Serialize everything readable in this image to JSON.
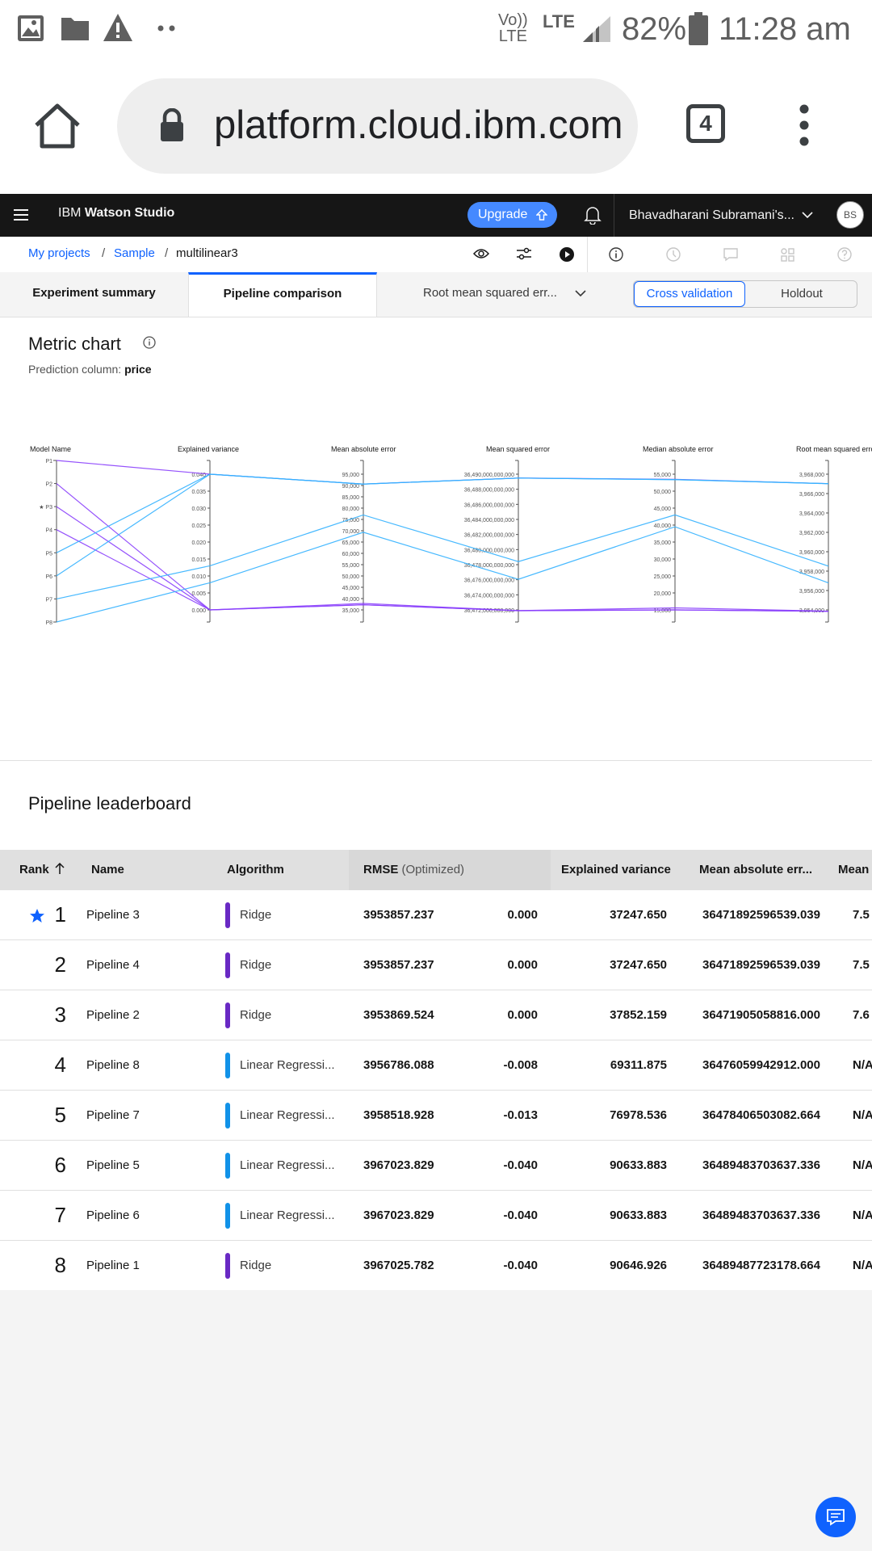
{
  "status_bar": {
    "battery": "82%",
    "time": "11:28 am",
    "net1_top": "Vo))",
    "net1_bottom": "LTE",
    "net2": "LTE"
  },
  "browser": {
    "url": "platform.cloud.ibm.com",
    "tab_count": "4"
  },
  "header": {
    "brand_prefix": "IBM",
    "brand_name": "Watson Studio",
    "upgrade_label": "Upgrade",
    "account_name": "Bhavadharani Subramani's...",
    "avatar_initials": "BS"
  },
  "breadcrumb": {
    "projects": "My projects",
    "sample": "Sample",
    "current": "multilinear3"
  },
  "tabs": {
    "summary": "Experiment summary",
    "comparison": "Pipeline comparison",
    "metric_select": "Root mean squared err...",
    "cross_validation": "Cross validation",
    "holdout": "Holdout"
  },
  "metric_chart": {
    "title": "Metric chart",
    "prediction_label": "Prediction column:",
    "prediction_value": "price"
  },
  "chart_data": {
    "type": "parallel-coordinates",
    "axes": [
      {
        "name": "Model Name",
        "ticks": [
          "P1",
          "P2",
          "★ P3",
          "P4",
          "P5",
          "P6",
          "P7",
          "P8"
        ]
      },
      {
        "name": "Explained variance",
        "ticks": [
          "0.040",
          "0.035",
          "0.030",
          "0.025",
          "0.020",
          "0.015",
          "0.010",
          "0.005",
          "0.000"
        ],
        "range": [
          0.0,
          0.04
        ]
      },
      {
        "name": "Mean absolute error",
        "ticks": [
          "95,000",
          "90,000",
          "85,000",
          "80,000",
          "75,000",
          "70,000",
          "65,000",
          "60,000",
          "55,000",
          "50,000",
          "45,000",
          "40,000",
          "35,000"
        ],
        "range": [
          35000,
          95000
        ]
      },
      {
        "name": "Mean squared error",
        "ticks": [
          "36,490,000,000,000",
          "36,488,000,000,000",
          "36,486,000,000,000",
          "36,484,000,000,000",
          "36,482,000,000,000",
          "36,480,000,000,000",
          "36,478,000,000,000",
          "36,476,000,000,000",
          "36,474,000,000,000",
          "36,472,000,000,000"
        ],
        "range": [
          36472000000000,
          36490000000000
        ]
      },
      {
        "name": "Median absolute error",
        "ticks": [
          "55,000",
          "50,000",
          "45,000",
          "40,000",
          "35,000",
          "30,000",
          "25,000",
          "20,000",
          "15,000"
        ],
        "range": [
          15000,
          55000
        ]
      },
      {
        "name": "Root mean squared error",
        "ticks": [
          "3,968,000",
          "3,966,000",
          "3,964,000",
          "3,962,000",
          "3,960,000",
          "3,958,000",
          "3,956,000",
          "3,954,000"
        ],
        "range": [
          3954000,
          3968000
        ]
      }
    ],
    "series": [
      {
        "model": "P1",
        "algorithm": "Ridge",
        "values": [
          0.04,
          90646.926,
          36489487723178.664,
          53500,
          3967025.782
        ]
      },
      {
        "model": "P2",
        "algorithm": "Ridge",
        "values": [
          0.0,
          37852.159,
          36471905058816.0,
          15600,
          3953869.524
        ]
      },
      {
        "model": "P3",
        "algorithm": "Ridge",
        "values": [
          0.0,
          37247.65,
          36471892596539.04,
          15000,
          3953857.237
        ]
      },
      {
        "model": "P4",
        "algorithm": "Ridge",
        "values": [
          0.0,
          37247.65,
          36471892596539.04,
          15000,
          3953857.237
        ]
      },
      {
        "model": "P5",
        "algorithm": "Linear Regression",
        "values": [
          0.04,
          90633.883,
          36489483703637.336,
          53400,
          3967023.829
        ]
      },
      {
        "model": "P6",
        "algorithm": "Linear Regression",
        "values": [
          0.04,
          90633.883,
          36489483703637.336,
          53400,
          3967023.829
        ]
      },
      {
        "model": "P7",
        "algorithm": "Linear Regression",
        "values": [
          0.013,
          76978.536,
          36478406503082.664,
          43000,
          3958518.928
        ]
      },
      {
        "model": "P8",
        "algorithm": "Linear Regression",
        "values": [
          0.008,
          69311.875,
          36476059942912.0,
          39500,
          3956786.088
        ]
      }
    ],
    "colors": {
      "Ridge": "#8a3ffc",
      "Linear Regression": "#33b1ff"
    }
  },
  "leaderboard": {
    "title": "Pipeline leaderboard",
    "headers": {
      "rank": "Rank",
      "name": "Name",
      "algorithm": "Algorithm",
      "rmse": "RMSE",
      "rmse_note": "(Optimized)",
      "explained_variance": "Explained variance",
      "mae": "Mean absolute err...",
      "next": "Mean"
    },
    "rows": [
      {
        "rank": "1",
        "name": "Pipeline 3",
        "algorithm": "Ridge",
        "color": "#6929c4",
        "rmse": "3953857.237",
        "ev": "0.000",
        "mae": "37247.650",
        "mse": "36471892596539.039",
        "extra": "7.5",
        "star": true
      },
      {
        "rank": "2",
        "name": "Pipeline 4",
        "algorithm": "Ridge",
        "color": "#6929c4",
        "rmse": "3953857.237",
        "ev": "0.000",
        "mae": "37247.650",
        "mse": "36471892596539.039",
        "extra": "7.5"
      },
      {
        "rank": "3",
        "name": "Pipeline 2",
        "algorithm": "Ridge",
        "color": "#6929c4",
        "rmse": "3953869.524",
        "ev": "0.000",
        "mae": "37852.159",
        "mse": "36471905058816.000",
        "extra": "7.6"
      },
      {
        "rank": "4",
        "name": "Pipeline 8",
        "algorithm": "Linear Regressi...",
        "color": "#1192e8",
        "rmse": "3956786.088",
        "ev": "-0.008",
        "mae": "69311.875",
        "mse": "36476059942912.000",
        "extra": "N/A"
      },
      {
        "rank": "5",
        "name": "Pipeline 7",
        "algorithm": "Linear Regressi...",
        "color": "#1192e8",
        "rmse": "3958518.928",
        "ev": "-0.013",
        "mae": "76978.536",
        "mse": "36478406503082.664",
        "extra": "N/A"
      },
      {
        "rank": "6",
        "name": "Pipeline 5",
        "algorithm": "Linear Regressi...",
        "color": "#1192e8",
        "rmse": "3967023.829",
        "ev": "-0.040",
        "mae": "90633.883",
        "mse": "36489483703637.336",
        "extra": "N/A"
      },
      {
        "rank": "7",
        "name": "Pipeline 6",
        "algorithm": "Linear Regressi...",
        "color": "#1192e8",
        "rmse": "3967023.829",
        "ev": "-0.040",
        "mae": "90633.883",
        "mse": "36489483703637.336",
        "extra": "N/A"
      },
      {
        "rank": "8",
        "name": "Pipeline 1",
        "algorithm": "Ridge",
        "color": "#6929c4",
        "rmse": "3967025.782",
        "ev": "-0.040",
        "mae": "90646.926",
        "mse": "36489487723178.664",
        "extra": "N/A"
      }
    ]
  }
}
